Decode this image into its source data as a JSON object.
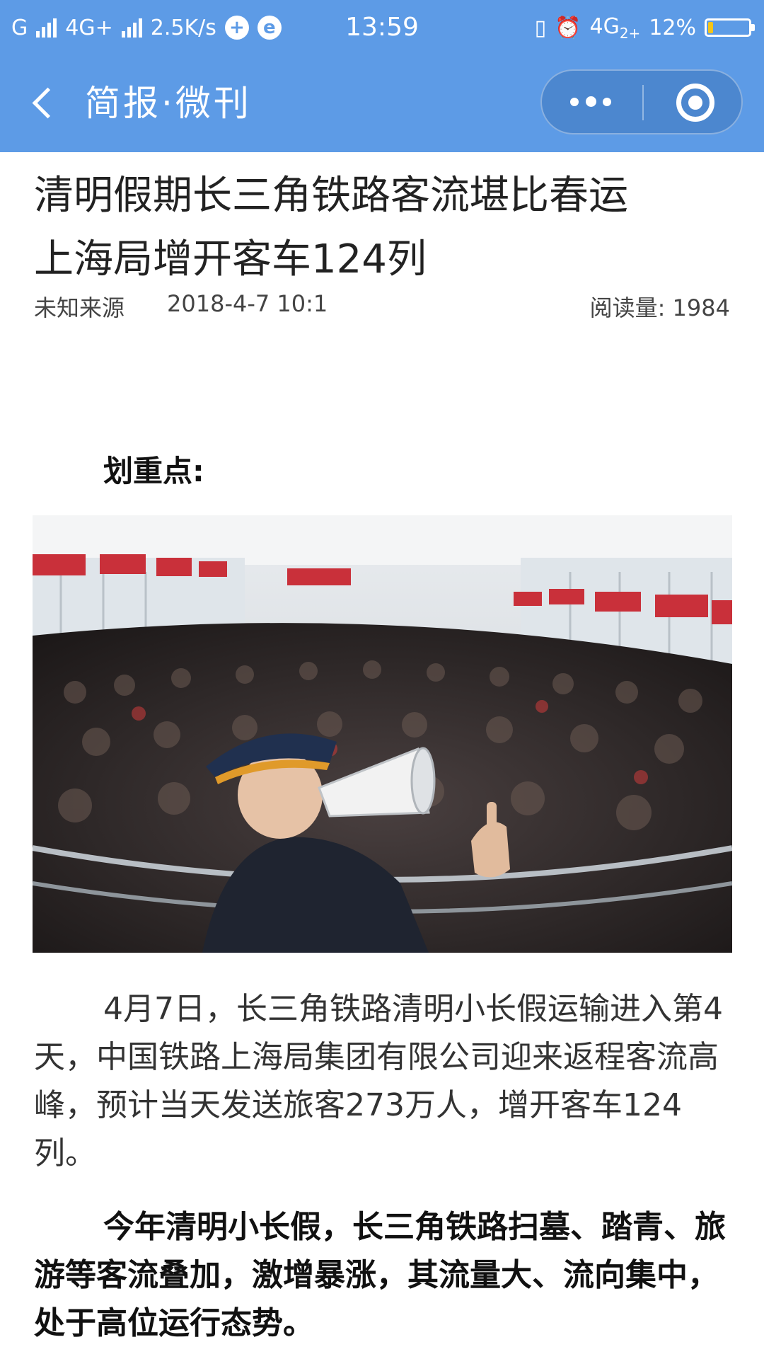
{
  "status_bar": {
    "carrier_left": "G",
    "network_1": "4G+",
    "speed": "2.5K/s",
    "time": "13:59",
    "network_2": "4G",
    "network_2_sub": "2+",
    "battery_percent": "12%",
    "battery_level": 0.12,
    "battery_color": "#f5c518"
  },
  "nav": {
    "title": "简报·微刊",
    "back_icon": "chevron-left-icon",
    "more_icon": "more-dots-icon",
    "close_icon": "target-circle-icon",
    "bar_color": "#5d9be6"
  },
  "article": {
    "title_line1": "清明假期长三角铁路客流堪比春运",
    "title_line2": "上海局增开客车124列",
    "source": "未知来源",
    "date": "2018-4-7 10:1",
    "reads_label": "阅读量: 1984",
    "highlight_label": "划重点:",
    "paragraph1": "4月7日，长三角铁路清明小长假运输进入第4天，中国铁路上海局集团有限公司迎来返程客流高峰，预计当天发送旅客273万人，增开客车124列。",
    "paragraph2": "今年清明小长假，长三角铁路扫墓、踏青、旅游等客流叠加，激增暴涨，其流量大、流向集中，处于高位运行态势。"
  }
}
